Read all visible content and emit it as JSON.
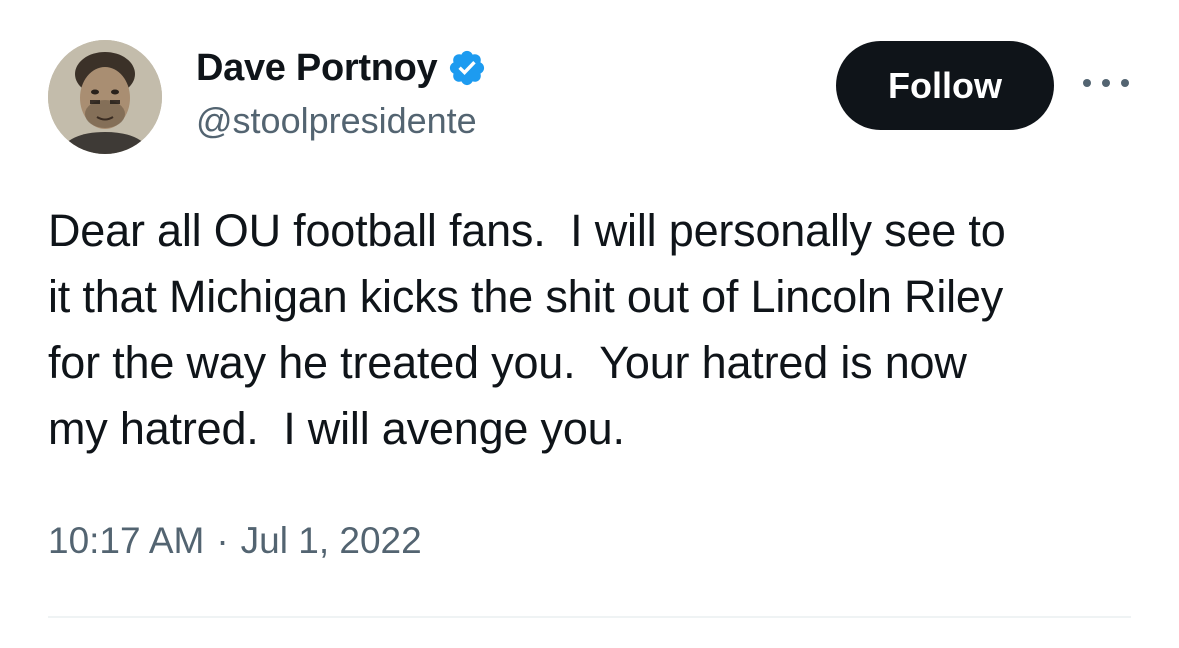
{
  "author": {
    "display_name": "Dave Portnoy",
    "handle": "@stoolpresidente",
    "verified_color": "#1d9bf0",
    "avatar_icon": "user-photo-avatar"
  },
  "actions": {
    "follow_label": "Follow",
    "more_icon": "ellipsis-icon"
  },
  "tweet": {
    "text_lines": [
      "Dear all OU football fans.  I will personally see to",
      "it that Michigan kicks the shit out of Lincoln Riley",
      "for the way he treated you.  Your hatred is now",
      "my hatred.  I will avenge you."
    ],
    "time": "10:17 AM",
    "separator": "·",
    "date": "Jul 1, 2022"
  },
  "colors": {
    "text_primary": "#0f1419",
    "text_secondary": "#536471",
    "button_bg": "#0f1419",
    "divider": "#eff3f4"
  }
}
